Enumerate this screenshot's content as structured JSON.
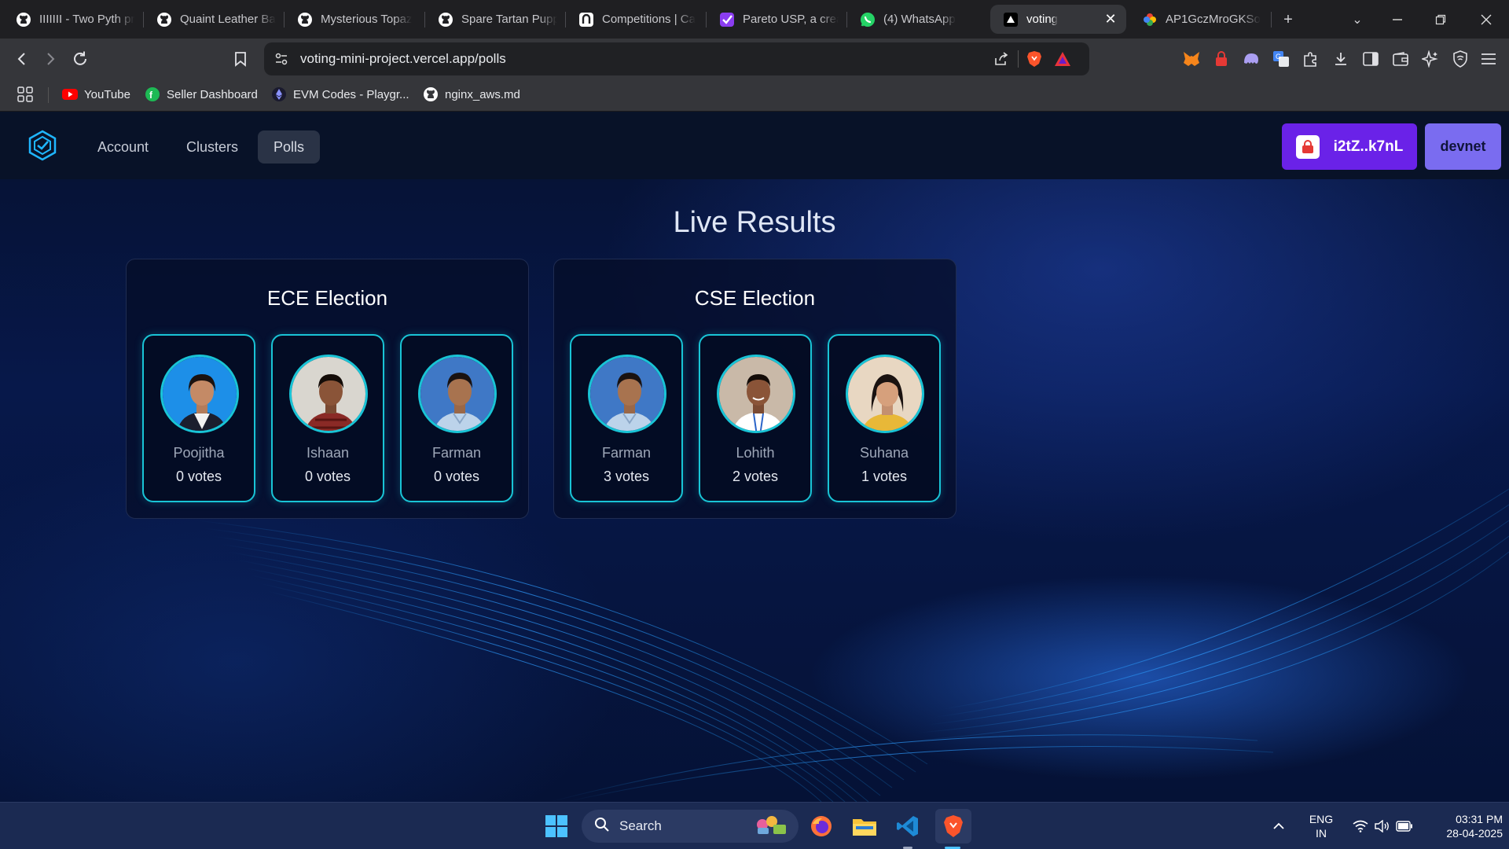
{
  "browser": {
    "tabs": [
      {
        "label": "IIIIIII - Two Pyth pr",
        "icon": "github-icon"
      },
      {
        "label": "Quaint Leather Ba",
        "icon": "github-icon"
      },
      {
        "label": "Mysterious Topaz",
        "icon": "github-icon"
      },
      {
        "label": "Spare Tartan Pupp",
        "icon": "github-icon"
      },
      {
        "label": "Competitions | Ca",
        "icon": "unstop-icon"
      },
      {
        "label": "Pareto USP, a crea",
        "icon": "pareto-icon"
      },
      {
        "label": "(4) WhatsApp",
        "icon": "whatsapp-icon"
      },
      {
        "label": "voting",
        "icon": "vercel-icon",
        "active": true
      },
      {
        "label": "AP1GczMroGKSo",
        "icon": "photos-icon"
      }
    ],
    "url": "voting-mini-project.vercel.app/polls",
    "bookmarks": [
      {
        "label": "YouTube",
        "icon": "youtube-icon"
      },
      {
        "label": "Seller Dashboard",
        "icon": "seller-icon"
      },
      {
        "label": "EVM Codes - Playgr...",
        "icon": "ethereum-icon"
      },
      {
        "label": "nginx_aws.md",
        "icon": "github-icon"
      }
    ]
  },
  "app": {
    "nav": [
      "Account",
      "Clusters",
      "Polls"
    ],
    "active_nav": "Polls",
    "wallet_label": "i2tZ..k7nL",
    "network_label": "devnet",
    "heading": "Live Results",
    "votes_suffix": "votes",
    "polls": [
      {
        "title": "ECE Election",
        "candidates": [
          {
            "name": "Poojitha",
            "votes": 0
          },
          {
            "name": "Ishaan",
            "votes": 0
          },
          {
            "name": "Farman",
            "votes": 0
          }
        ]
      },
      {
        "title": "CSE Election",
        "candidates": [
          {
            "name": "Farman",
            "votes": 3
          },
          {
            "name": "Lohith",
            "votes": 2
          },
          {
            "name": "Suhana",
            "votes": 1
          }
        ]
      }
    ],
    "colors": {
      "accent": "#19c4d6",
      "wallet": "#6a22e8",
      "network": "#7a6cf0"
    }
  },
  "taskbar": {
    "search_label": "Search",
    "lang_top": "ENG",
    "lang_bottom": "IN",
    "time": "03:31 PM",
    "date": "28-04-2025"
  }
}
